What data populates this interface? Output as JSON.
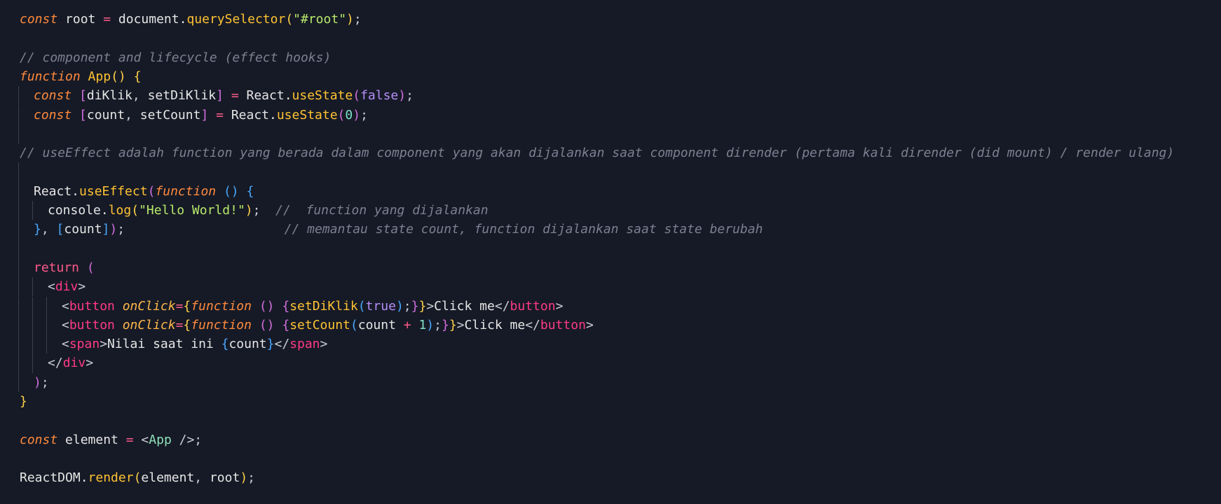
{
  "editor": {
    "background": "#161a26",
    "lines": [
      {
        "indent": 0,
        "tokens": [
          {
            "t": "const",
            "c": "kw"
          },
          {
            "t": " root ",
            "c": "var"
          },
          {
            "t": "=",
            "c": "op"
          },
          {
            "t": " document.",
            "c": "var"
          },
          {
            "t": "querySelector",
            "c": "fn"
          },
          {
            "t": "(",
            "c": "b1"
          },
          {
            "t": "\"#root\"",
            "c": "str"
          },
          {
            "t": ")",
            "c": "b1"
          },
          {
            "t": ";",
            "c": "punct"
          }
        ]
      },
      {
        "indent": 0,
        "tokens": []
      },
      {
        "indent": 0,
        "tokens": [
          {
            "t": "// component and lifecycle (effect hooks)",
            "c": "cm"
          }
        ]
      },
      {
        "indent": 0,
        "tokens": [
          {
            "t": "function",
            "c": "kw"
          },
          {
            "t": " ",
            "c": "var"
          },
          {
            "t": "App",
            "c": "fn"
          },
          {
            "t": "()",
            "c": "b1"
          },
          {
            "t": " ",
            "c": "var"
          },
          {
            "t": "{",
            "c": "b1"
          }
        ]
      },
      {
        "indent": 1,
        "tokens": [
          {
            "t": "const",
            "c": "kw"
          },
          {
            "t": " ",
            "c": "var"
          },
          {
            "t": "[",
            "c": "b2"
          },
          {
            "t": "diKlik",
            "c": "var"
          },
          {
            "t": ", ",
            "c": "punct"
          },
          {
            "t": "setDiKlik",
            "c": "var"
          },
          {
            "t": "]",
            "c": "b2"
          },
          {
            "t": " ",
            "c": "var"
          },
          {
            "t": "=",
            "c": "op"
          },
          {
            "t": " React.",
            "c": "var"
          },
          {
            "t": "useState",
            "c": "fn"
          },
          {
            "t": "(",
            "c": "b2"
          },
          {
            "t": "false",
            "c": "bool"
          },
          {
            "t": ")",
            "c": "b2"
          },
          {
            "t": ";",
            "c": "punct"
          }
        ]
      },
      {
        "indent": 1,
        "tokens": [
          {
            "t": "const",
            "c": "kw"
          },
          {
            "t": " ",
            "c": "var"
          },
          {
            "t": "[",
            "c": "b2"
          },
          {
            "t": "count",
            "c": "var"
          },
          {
            "t": ", ",
            "c": "punct"
          },
          {
            "t": "setCount",
            "c": "var"
          },
          {
            "t": "]",
            "c": "b2"
          },
          {
            "t": " ",
            "c": "var"
          },
          {
            "t": "=",
            "c": "op"
          },
          {
            "t": " React.",
            "c": "var"
          },
          {
            "t": "useState",
            "c": "fn"
          },
          {
            "t": "(",
            "c": "b2"
          },
          {
            "t": "0",
            "c": "num"
          },
          {
            "t": ")",
            "c": "b2"
          },
          {
            "t": ";",
            "c": "punct"
          }
        ]
      },
      {
        "indent": 1,
        "tokens": []
      },
      {
        "indent": 0,
        "tokens": [
          {
            "t": "// useEffect adalah function yang berada dalam component yang akan dijalankan saat component dirender (pertama kali dirender (did mount) / render ulang)",
            "c": "cm"
          }
        ]
      },
      {
        "indent": 1,
        "tokens": []
      },
      {
        "indent": 1,
        "tokens": [
          {
            "t": "React.",
            "c": "var"
          },
          {
            "t": "useEffect",
            "c": "fn"
          },
          {
            "t": "(",
            "c": "b2"
          },
          {
            "t": "function",
            "c": "kw"
          },
          {
            "t": " ",
            "c": "var"
          },
          {
            "t": "()",
            "c": "b3"
          },
          {
            "t": " ",
            "c": "var"
          },
          {
            "t": "{",
            "c": "b3"
          }
        ]
      },
      {
        "indent": 2,
        "tokens": [
          {
            "t": "console.",
            "c": "var"
          },
          {
            "t": "log",
            "c": "fn"
          },
          {
            "t": "(",
            "c": "b1"
          },
          {
            "t": "\"Hello World!\"",
            "c": "str"
          },
          {
            "t": ")",
            "c": "b1"
          },
          {
            "t": ";",
            "c": "punct"
          },
          {
            "t": "  ",
            "c": "var"
          },
          {
            "t": "//  function yang dijalankan",
            "c": "cm"
          }
        ]
      },
      {
        "indent": 1,
        "tokens": [
          {
            "t": "}",
            "c": "b3"
          },
          {
            "t": ", ",
            "c": "punct"
          },
          {
            "t": "[",
            "c": "b3"
          },
          {
            "t": "count",
            "c": "var"
          },
          {
            "t": "]",
            "c": "b3"
          },
          {
            "t": ")",
            "c": "b2"
          },
          {
            "t": ";",
            "c": "punct"
          },
          {
            "t": "                     ",
            "c": "var"
          },
          {
            "t": "// memantau state count, function dijalankan saat state berubah",
            "c": "cm"
          }
        ]
      },
      {
        "indent": 1,
        "tokens": []
      },
      {
        "indent": 1,
        "tokens": [
          {
            "t": "return",
            "c": "ret"
          },
          {
            "t": " ",
            "c": "var"
          },
          {
            "t": "(",
            "c": "b2"
          }
        ]
      },
      {
        "indent": 2,
        "tokens": [
          {
            "t": "<",
            "c": "punct"
          },
          {
            "t": "div",
            "c": "tag"
          },
          {
            "t": ">",
            "c": "punct"
          }
        ]
      },
      {
        "indent": 3,
        "tokens": [
          {
            "t": "<",
            "c": "punct"
          },
          {
            "t": "button",
            "c": "tag"
          },
          {
            "t": " ",
            "c": "var"
          },
          {
            "t": "onClick",
            "c": "attr"
          },
          {
            "t": "=",
            "c": "op"
          },
          {
            "t": "{",
            "c": "b1"
          },
          {
            "t": "function",
            "c": "kw"
          },
          {
            "t": " ",
            "c": "var"
          },
          {
            "t": "()",
            "c": "b2"
          },
          {
            "t": " ",
            "c": "var"
          },
          {
            "t": "{",
            "c": "b2"
          },
          {
            "t": "setDiKlik",
            "c": "fn"
          },
          {
            "t": "(",
            "c": "b3"
          },
          {
            "t": "true",
            "c": "bool"
          },
          {
            "t": ")",
            "c": "b3"
          },
          {
            "t": ";",
            "c": "punct"
          },
          {
            "t": "}",
            "c": "b2"
          },
          {
            "t": "}",
            "c": "b1"
          },
          {
            "t": ">",
            "c": "punct"
          },
          {
            "t": "Click me",
            "c": "var"
          },
          {
            "t": "</",
            "c": "punct"
          },
          {
            "t": "button",
            "c": "tag"
          },
          {
            "t": ">",
            "c": "punct"
          }
        ]
      },
      {
        "indent": 3,
        "tokens": [
          {
            "t": "<",
            "c": "punct"
          },
          {
            "t": "button",
            "c": "tag"
          },
          {
            "t": " ",
            "c": "var"
          },
          {
            "t": "onClick",
            "c": "attr"
          },
          {
            "t": "=",
            "c": "op"
          },
          {
            "t": "{",
            "c": "b1"
          },
          {
            "t": "function",
            "c": "kw"
          },
          {
            "t": " ",
            "c": "var"
          },
          {
            "t": "()",
            "c": "b2"
          },
          {
            "t": " ",
            "c": "var"
          },
          {
            "t": "{",
            "c": "b2"
          },
          {
            "t": "setCount",
            "c": "fn"
          },
          {
            "t": "(",
            "c": "b3"
          },
          {
            "t": "count ",
            "c": "var"
          },
          {
            "t": "+",
            "c": "op"
          },
          {
            "t": " ",
            "c": "var"
          },
          {
            "t": "1",
            "c": "num"
          },
          {
            "t": ")",
            "c": "b3"
          },
          {
            "t": ";",
            "c": "punct"
          },
          {
            "t": "}",
            "c": "b2"
          },
          {
            "t": "}",
            "c": "b1"
          },
          {
            "t": ">",
            "c": "punct"
          },
          {
            "t": "Click me",
            "c": "var"
          },
          {
            "t": "</",
            "c": "punct"
          },
          {
            "t": "button",
            "c": "tag"
          },
          {
            "t": ">",
            "c": "punct"
          }
        ]
      },
      {
        "indent": 3,
        "tokens": [
          {
            "t": "<",
            "c": "punct"
          },
          {
            "t": "span",
            "c": "tag"
          },
          {
            "t": ">",
            "c": "punct"
          },
          {
            "t": "Nilai saat ini ",
            "c": "var"
          },
          {
            "t": "{",
            "c": "b3"
          },
          {
            "t": "count",
            "c": "var"
          },
          {
            "t": "}",
            "c": "b3"
          },
          {
            "t": "</",
            "c": "punct"
          },
          {
            "t": "span",
            "c": "tag"
          },
          {
            "t": ">",
            "c": "punct"
          }
        ]
      },
      {
        "indent": 2,
        "tokens": [
          {
            "t": "</",
            "c": "punct"
          },
          {
            "t": "div",
            "c": "tag"
          },
          {
            "t": ">",
            "c": "punct"
          }
        ]
      },
      {
        "indent": 1,
        "tokens": [
          {
            "t": ")",
            "c": "b2"
          },
          {
            "t": ";",
            "c": "punct"
          }
        ]
      },
      {
        "indent": 0,
        "tokens": [
          {
            "t": "}",
            "c": "b1"
          }
        ]
      },
      {
        "indent": 0,
        "tokens": []
      },
      {
        "indent": 0,
        "tokens": [
          {
            "t": "const",
            "c": "kw"
          },
          {
            "t": " element ",
            "c": "var"
          },
          {
            "t": "=",
            "c": "op"
          },
          {
            "t": " ",
            "c": "var"
          },
          {
            "t": "<",
            "c": "punct"
          },
          {
            "t": "App",
            "c": "comp"
          },
          {
            "t": " />",
            "c": "punct"
          },
          {
            "t": ";",
            "c": "punct"
          }
        ]
      },
      {
        "indent": 0,
        "tokens": []
      },
      {
        "indent": 0,
        "tokens": [
          {
            "t": "ReactDOM.",
            "c": "var"
          },
          {
            "t": "render",
            "c": "fn"
          },
          {
            "t": "(",
            "c": "b1"
          },
          {
            "t": "element",
            "c": "var"
          },
          {
            "t": ", ",
            "c": "punct"
          },
          {
            "t": "root",
            "c": "var"
          },
          {
            "t": ")",
            "c": "b1"
          },
          {
            "t": ";",
            "c": "punct"
          }
        ]
      }
    ]
  }
}
